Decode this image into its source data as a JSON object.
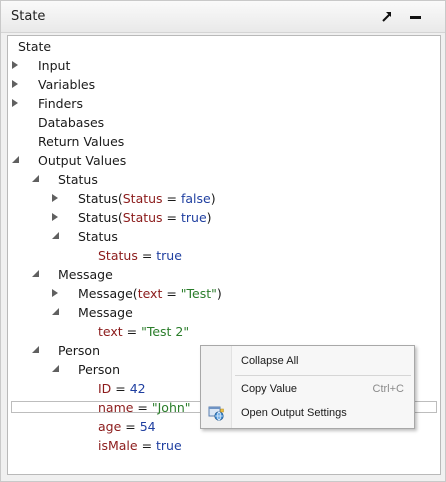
{
  "panel": {
    "title": "State",
    "maximize_icon": "maximize-arrow-icon",
    "minimize_icon": "minimize-icon"
  },
  "tree": {
    "root": "State",
    "input": "Input",
    "variables": "Variables",
    "finders": "Finders",
    "databases": "Databases",
    "return_values": "Return Values",
    "output_values": "Output Values",
    "status_group": "Status",
    "status1": {
      "name": "Status",
      "paren_open": "(",
      "key": "Status",
      "eq": " = ",
      "value": "false",
      "paren_close": ")"
    },
    "status2": {
      "name": "Status",
      "paren_open": "(",
      "key": "Status",
      "eq": " = ",
      "value": "true",
      "paren_close": ")"
    },
    "status3": "Status",
    "status3_field": {
      "key": "Status",
      "eq": " = ",
      "value": "true"
    },
    "message_group": "Message",
    "message1": {
      "name": "Message",
      "paren_open": "(",
      "key": "text",
      "eq": " = ",
      "value": "\"Test\"",
      "paren_close": ")"
    },
    "message2": "Message",
    "message2_field": {
      "key": "text",
      "eq": " = ",
      "value": "\"Test 2\""
    },
    "person_group": "Person",
    "person": "Person",
    "fields": {
      "id": {
        "key": "ID",
        "eq": " = ",
        "value": "42"
      },
      "name": {
        "key": "name",
        "eq": " = ",
        "value": "\"John\""
      },
      "age": {
        "key": "age",
        "eq": " = ",
        "value": "54"
      },
      "ismale": {
        "key": "isMale",
        "eq": " = ",
        "value": "true"
      }
    }
  },
  "context_menu": {
    "collapse_all": "Collapse All",
    "copy_value": "Copy Value",
    "copy_value_shortcut": "Ctrl+C",
    "open_output_settings": "Open Output Settings",
    "settings_icon": "settings-globe-icon"
  },
  "colors": {
    "field_name": "#8b1a1a",
    "boolean": "#1f3fa0",
    "number": "#1f3fa0",
    "string": "#2a7d2a"
  }
}
